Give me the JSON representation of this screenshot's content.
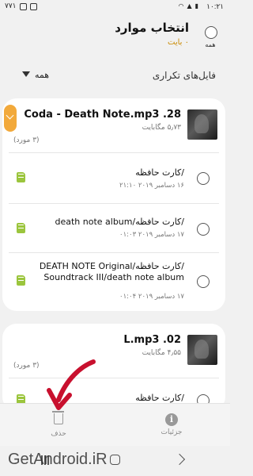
{
  "status_bar": {
    "time": "۱۰:۲۱",
    "notification_text": "۷۷۱"
  },
  "header": {
    "title": "انتخاب موارد",
    "subtitle": "۰ بایت",
    "select_all_label": "همه"
  },
  "filter": {
    "label": "فایل‌های تکراری",
    "selected": "همه"
  },
  "groups": [
    {
      "title": "28. Coda - Death Note.mp3",
      "size": "۵٫۷۳ مگابایت",
      "count": "(۳ مورد)",
      "files": [
        {
          "path": "/کارت حافظه",
          "date": "۱۶ دسامبر ۲۰۱۹ ۲۱:۱۰"
        },
        {
          "path": "/کارت حافظه/death note album",
          "date": "۱۷ دسامبر ۲۰۱۹ ۰۱:۰۳"
        },
        {
          "path": "/کارت حافظه/DEATH NOTE Original Soundtrack III/death note album",
          "date": "۱۷ دسامبر ۲۰۱۹ ۰۱:۰۴"
        }
      ]
    },
    {
      "title": "02. L.mp3",
      "size": "۴٫۵۵ مگابایت",
      "count": "(۳ مورد)",
      "files": [
        {
          "path": "/کارت حافظه",
          "date": ""
        }
      ]
    }
  ],
  "actions": {
    "delete_label": "حذف",
    "details_label": "جزئیات"
  },
  "watermark": "GetAndroid.iR",
  "colors": {
    "accent": "#f2a93b",
    "sd_card": "#9bc53d",
    "annotation_arrow": "#c8102e",
    "subtitle": "#c98a00"
  },
  "icons": {
    "delete": "trash-icon",
    "details": "info-icon",
    "sd": "sd-card-icon"
  }
}
